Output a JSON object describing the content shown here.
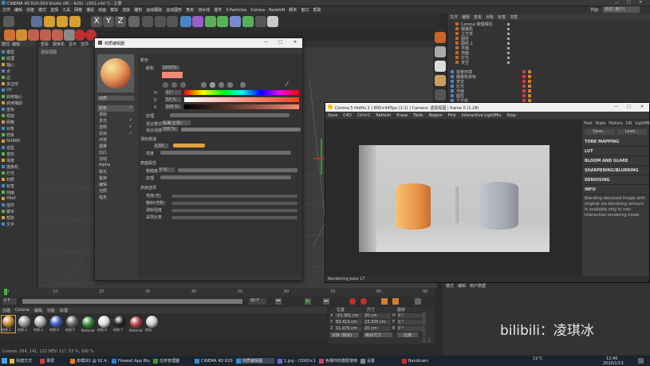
{
  "app": {
    "title": "CINEMA 4D R20.059 Studio (RC - R20) - [001.c4d *] - 主要",
    "menu": [
      "文件",
      "编辑",
      "创建",
      "模式",
      "选择",
      "工具",
      "网格",
      "捕捉",
      "动画",
      "模拟",
      "渲染",
      "雕刻",
      "运动跟踪",
      "运动图形",
      "角色",
      "流水线",
      "插件",
      "X-Particles",
      "Corona",
      "Redshift",
      "脚本",
      "窗口",
      "帮助"
    ],
    "layout_label": "界面:",
    "layout_value": "启动 (用户)",
    "toolbar_axes": [
      "X",
      "Y",
      "Z"
    ]
  },
  "left_panel": {
    "tabs": [
      "模式",
      "编辑",
      "用户数据"
    ],
    "items": [
      "模型",
      "纹理",
      "轴心",
      "点",
      "边",
      "多边形",
      "UV",
      "启用轴心",
      "启用捕捉",
      "坐标",
      "视窗",
      "网格",
      "对象",
      "样条",
      "NURBS",
      "造型",
      "变形",
      "场景",
      "摄像机",
      "灯光",
      "材质",
      "标签",
      "动画",
      "XRef",
      "插件",
      "脚本",
      "帮助",
      "文字"
    ]
  },
  "viewport": {
    "menu": [
      "查看",
      "摄像机",
      "显示",
      "选项",
      "过滤",
      "面板",
      "ProRender"
    ],
    "label": "透视视图"
  },
  "material_editor": {
    "title": "材质编辑器",
    "preview_name": "材质",
    "channels": [
      "颜色",
      "漫射",
      "发光",
      "透明",
      "反射",
      "环境",
      "烟雾",
      "凹凸",
      "法线",
      "Alpha",
      "辉光",
      "置换",
      "编辑",
      "光照",
      "指定"
    ],
    "channel_checks": [
      true,
      false,
      true,
      true,
      true,
      false,
      false,
      false,
      false,
      false,
      false,
      false,
      false,
      false,
      false
    ],
    "section_title": "颜色",
    "color_label": "颜色",
    "h_label": "H",
    "h_value": "11°",
    "s_label": "S",
    "s_value": "53 %",
    "v_label": "V",
    "v_value": "100 %",
    "color_hex": "#f28a75",
    "texture_label": "纹理",
    "mix_mode_label": "混合模式",
    "mix_mode_value": "标准(正常)",
    "mix_strength_label": "混合强度",
    "mix_strength_value": "100 %",
    "model_label": "漫射衰减",
    "model_value": "1.50",
    "brightness_label": "亮度",
    "section2": "表面属性",
    "roughness_label": "粗糙度",
    "roughness_value": "0 %",
    "texture2_label": "纹理",
    "section3": "高级选项",
    "adv_items": [
      "亮度(倍)",
      "散射(倍数)",
      "漫射强度",
      "采样比率"
    ],
    "adv_value": "100 %"
  },
  "object_manager": {
    "menu": [
      "文件",
      "编辑",
      "查看",
      "对象",
      "标签",
      "书签"
    ],
    "items": [
      "Corona 物理相机",
      "摄像机",
      "立方体",
      "圆柱",
      "圆柱.1",
      "平面",
      "地面",
      "灯光",
      "天空"
    ],
    "lower_items": [
      "背景环境",
      "摄像机目标",
      "天空",
      "灯光",
      "平面",
      "圆柱",
      "立方体"
    ]
  },
  "corona_vfb": {
    "title": "Corona 5 Hotfix 2 | 800×445px (1:1) | Camera: 透视视图 | frame 0 (1.28)",
    "toolbar": [
      "Save",
      "C4D",
      "Ctrl+C",
      "Refresh",
      "Erase",
      "Tools",
      "Region",
      "Pick",
      "Interactive LightMix",
      "Stop"
    ],
    "tabs": [
      "Post",
      "Stats",
      "History",
      "DR",
      "LightMix"
    ],
    "buttons": [
      "Save...",
      "Load..."
    ],
    "sections": [
      "TONE MAPPING",
      "LUT",
      "BLOOM AND GLARE",
      "SHARPENING/BLURRING",
      "DENOISING",
      "INFO"
    ],
    "info_text": "Blending denoised image with original via denoising amount is available only in non-interactive rendering mode",
    "status": "Rendering pass 17",
    "render_bg": "#c9c9c9"
  },
  "timeline": {
    "ticks": [
      "0",
      "10",
      "20",
      "30",
      "40",
      "50",
      "60",
      "70",
      "80",
      "90"
    ],
    "frame_start": "0 F",
    "frame_end": "90 F",
    "current": "0 F"
  },
  "material_shelf": {
    "menu": [
      "创建",
      "Corona",
      "编辑",
      "功能",
      "纹理"
    ],
    "materials": [
      "材质.1",
      "材质.2",
      "材质.3",
      "材质.4",
      "材质.5",
      "Material",
      "材质.6",
      "材质.7",
      "Material",
      "玻璃"
    ]
  },
  "coords": {
    "headers": [
      "位置",
      "尺寸",
      "旋转"
    ],
    "rows": [
      {
        "axis": "X",
        "pos": "-15.381 cm",
        "size": "20 cm",
        "rot_axis": "H",
        "rot": "0 °"
      },
      {
        "axis": "Y",
        "pos": "83.413 cm",
        "size": "23.335 cm",
        "rot_axis": "P",
        "rot": "0 °"
      },
      {
        "axis": "Z",
        "pos": "11.076 cm",
        "size": "20 cm",
        "rot_axis": "B",
        "rot": "0 °"
      }
    ],
    "mode1": "对象 (相对)",
    "mode2": "绝对尺寸",
    "apply": "应用"
  },
  "status_bar": {
    "text": "Corona: 294, 141, 122   HEV: 11°, 53 %, 100 %"
  },
  "watermark": "bilibili：凌琪冰",
  "maxon": "MAXON CINEMA 4D",
  "taskbar": {
    "items": [
      "快捷方式",
      "录屏",
      "单模块1 @ 92.4...",
      "Firewall App Blo...",
      "任务管理器",
      "CINEMA 4D R20...",
      "材质编辑器",
      "1.jpg - (3000×16...",
      "色相环的搭配使用...",
      "设置",
      "Bandicam"
    ],
    "weather": "11°C",
    "time": "12:40",
    "date": "2020/1/13"
  }
}
